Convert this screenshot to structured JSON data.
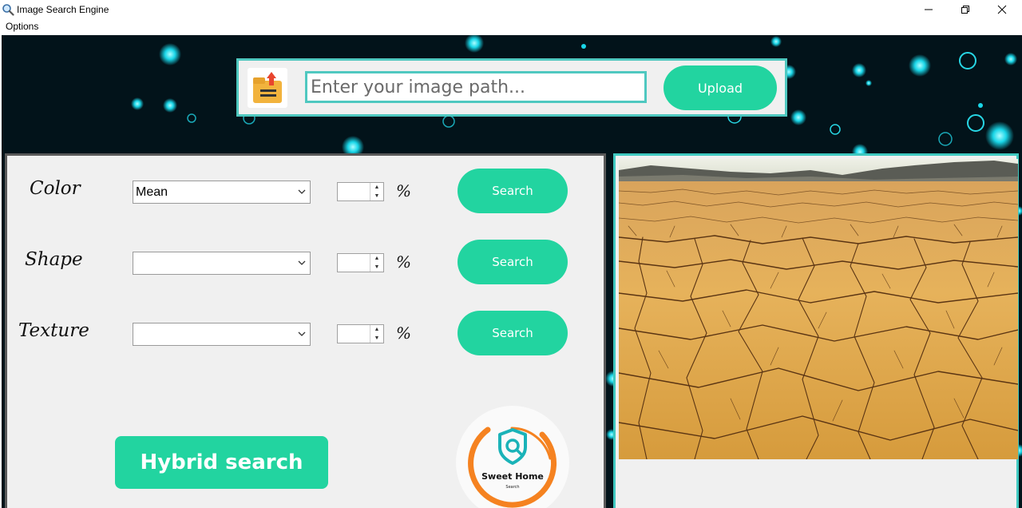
{
  "window": {
    "title": "Image Search Engine"
  },
  "menu": {
    "options_label": "Options"
  },
  "upload": {
    "placeholder": "Enter your image path...",
    "button_label": "Upload"
  },
  "features": [
    {
      "label": "Color",
      "selected": "Mean",
      "percent_symbol": "%",
      "button_label": "Search"
    },
    {
      "label": "Shape",
      "selected": "",
      "percent_symbol": "%",
      "button_label": "Search"
    },
    {
      "label": "Texture",
      "selected": "",
      "percent_symbol": "%",
      "button_label": "Search"
    }
  ],
  "hybrid": {
    "button_label": "Hybrid search"
  },
  "logo": {
    "name": "Sweet Home",
    "sub": "Search"
  },
  "colors": {
    "accent": "#22d4a0",
    "border": "#4fc8c0",
    "background": "#02131a",
    "panel": "#f0f0f0"
  },
  "icons": [
    "search-icon",
    "minimize-icon",
    "maximize-icon",
    "close-icon",
    "folder-upload-icon",
    "chevron-down-icon"
  ]
}
